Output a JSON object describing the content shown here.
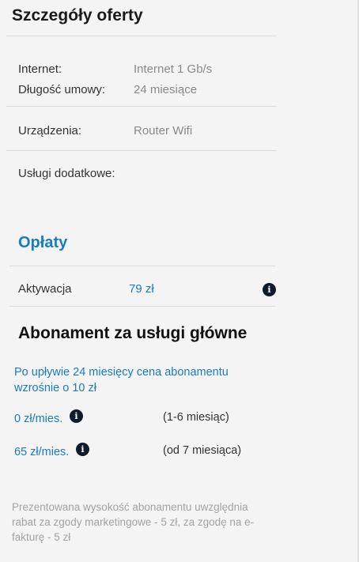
{
  "offer": {
    "title": "Szczegóły oferty",
    "rows": [
      {
        "label": "Internet:",
        "value": "Internet 1 Gb/s"
      },
      {
        "label": "Długość umowy:",
        "value": "24 miesiące"
      },
      {
        "label": "Urządzenia:",
        "value": "Router Wifi"
      },
      {
        "label": "Usługi dodatkowe:",
        "value": ""
      }
    ]
  },
  "fees": {
    "heading": "Opłaty",
    "activation_label": "Aktywacja",
    "activation_value": "79 zł"
  },
  "subscription": {
    "heading": "Abonament za usługi główne",
    "notice": "Po upływie 24 miesięcy cena abonamentu wzrośnie o 10 zł",
    "tiers": [
      {
        "price": "0 zł/mies.",
        "period": "(1-6 miesiąc)"
      },
      {
        "price": "65 zł/mies.",
        "period": "(od 7 miesiąca)"
      }
    ]
  },
  "footnote": "Prezentowana wysokość abonamentu uwzględnia rabat za zgody marketingowe - 5 zł, za zgodę na e-fakturę - 5 zł",
  "icons": {
    "info": "info-icon"
  },
  "colors": {
    "accent": "#1a7bc2",
    "icon_bg": "#0d1b2a",
    "muted": "#8a8a8a"
  }
}
